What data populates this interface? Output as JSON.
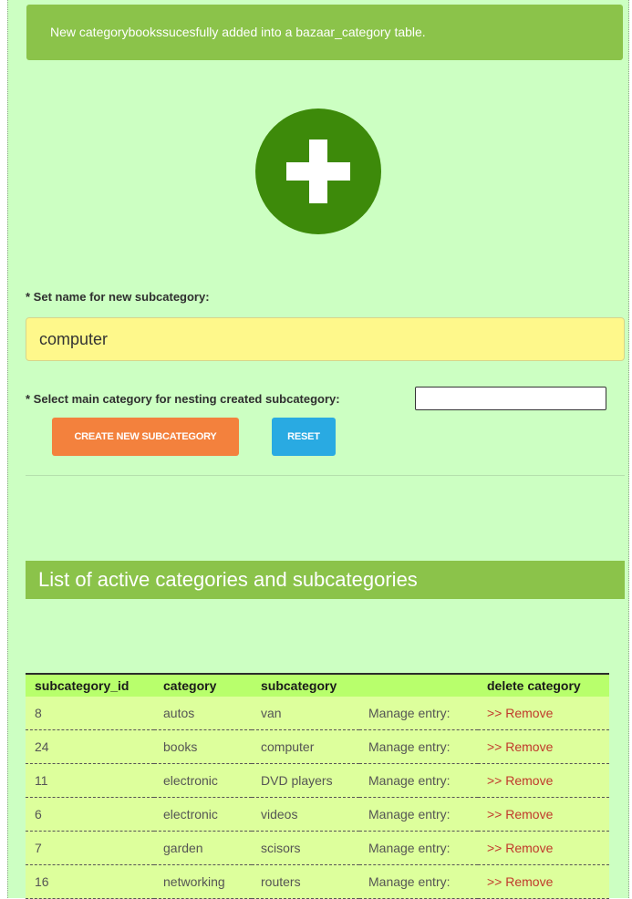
{
  "notice": {
    "text": "New categorybookssucesfully added into a bazaar_category table."
  },
  "add_icon": {
    "name": "plus-circle-icon",
    "color": "#3d8a0a"
  },
  "form": {
    "name_label": "* Set name for new subcategory:",
    "name_value": "computer",
    "main_category_label": "* Select main category for nesting created subcategory:",
    "main_category_value": "",
    "create_button": "CREATE NEW SUBCATEGORY",
    "reset_button": "RESET"
  },
  "list": {
    "title": "List of active categories and subcategories",
    "columns": [
      "subcategory_id",
      "category",
      "subcategory",
      "",
      "delete category"
    ],
    "rows": [
      {
        "id": "8",
        "category": "autos",
        "subcategory": "van",
        "manage": "Manage entry:",
        "remove": ">> Remove"
      },
      {
        "id": "24",
        "category": "books",
        "subcategory": "computer",
        "manage": "Manage entry:",
        "remove": ">> Remove"
      },
      {
        "id": "11",
        "category": "electronic",
        "subcategory": "DVD players",
        "manage": "Manage entry:",
        "remove": ">> Remove"
      },
      {
        "id": "6",
        "category": "electronic",
        "subcategory": "videos",
        "manage": "Manage entry:",
        "remove": ">> Remove"
      },
      {
        "id": "7",
        "category": "garden",
        "subcategory": "scisors",
        "manage": "Manage entry:",
        "remove": ">> Remove"
      },
      {
        "id": "16",
        "category": "networking",
        "subcategory": "routers",
        "manage": "Manage entry:",
        "remove": ">> Remove"
      }
    ]
  },
  "colors": {
    "panel_bg": "#ccffc2",
    "accent_green": "#8bc34a",
    "create_orange": "#f3813d",
    "reset_blue": "#29aae2",
    "input_yellow": "#fef88b",
    "remove_red": "#c0392b"
  }
}
